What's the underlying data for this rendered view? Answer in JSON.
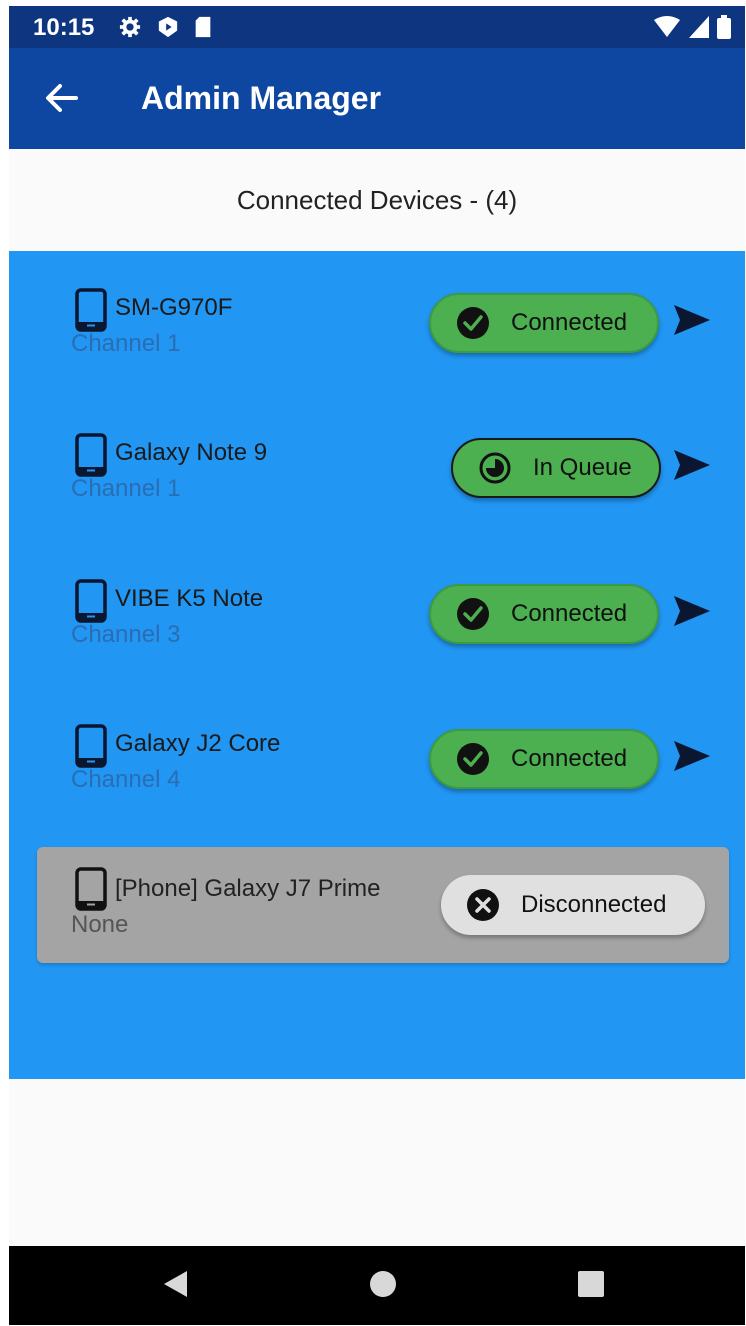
{
  "status_bar": {
    "time": "10:15",
    "icons": [
      "settings-icon",
      "play-shield-icon",
      "sd-card-icon",
      "wifi-icon",
      "signal-icon",
      "battery-icon"
    ]
  },
  "app_bar": {
    "title": "Admin Manager",
    "back_icon": "arrow-back-icon"
  },
  "heading": "Connected Devices - (4)",
  "colors": {
    "status_bar": "#0d3580",
    "app_bar": "#0d47a1",
    "device_area": "#2196f3",
    "connected": "#4caf50",
    "disconnected_card": "#a4a4a4",
    "disconnected_pill": "#e0e0e0"
  },
  "devices": [
    {
      "name": "SM-G970F",
      "channel": "Channel 1",
      "status": "Connected",
      "status_icon": "check-circle-icon"
    },
    {
      "name": "Galaxy Note 9",
      "channel": "Channel 1",
      "status": "In Queue",
      "status_icon": "clock-icon"
    },
    {
      "name": "VIBE K5 Note",
      "channel": "Channel 3",
      "status": "Connected",
      "status_icon": "check-circle-icon"
    },
    {
      "name": "Galaxy J2 Core",
      "channel": "Channel 4",
      "status": "Connected",
      "status_icon": "check-circle-icon"
    }
  ],
  "disconnected_device": {
    "name": "[Phone] Galaxy J7 Prime",
    "channel": "None",
    "status": "Disconnected",
    "status_icon": "cancel-icon"
  },
  "nav_bar": [
    "back-triangle-icon",
    "home-circle-icon",
    "recents-square-icon"
  ]
}
